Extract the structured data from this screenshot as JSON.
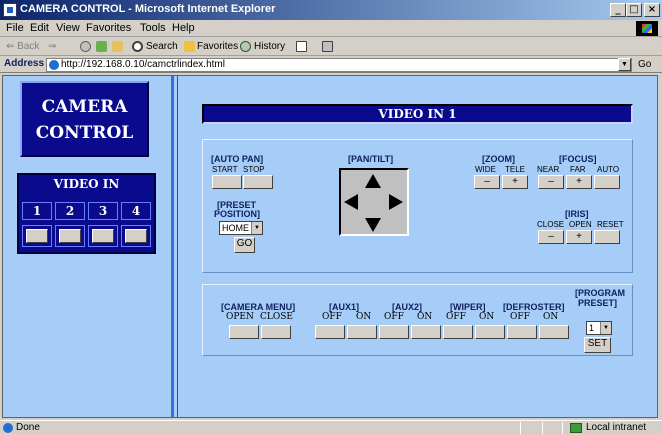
{
  "window": {
    "title": "CAMERA CONTROL - Microsoft Internet Explorer",
    "controls": [
      "_",
      "□",
      "×"
    ]
  },
  "menu": [
    "File",
    "Edit",
    "View",
    "Favorites",
    "Tools",
    "Help"
  ],
  "toolbar": {
    "back": "⇐ Back",
    "forward": "⇒",
    "search": "Search",
    "favorites": "Favorites",
    "history": "History"
  },
  "address": {
    "label": "Address",
    "url": "http://192.168.0.10/camctrlindex.html",
    "go": "Go"
  },
  "left": {
    "logo_line1": "CAMERA",
    "logo_line2": "CONTROL",
    "video_in_title": "VIDEO IN",
    "video_inputs": [
      "1",
      "2",
      "3",
      "4"
    ]
  },
  "main": {
    "title": "VIDEO IN 1",
    "auto_pan": {
      "label": "[AUTO PAN]",
      "start": "START",
      "stop": "STOP"
    },
    "pan_tilt": {
      "label": "[PAN/TILT]"
    },
    "zoom": {
      "label": "[ZOOM]",
      "wide": "WIDE",
      "tele": "TELE",
      "minus": "–",
      "plus": "+"
    },
    "focus": {
      "label": "[FOCUS]",
      "near": "NEAR",
      "far": "FAR",
      "auto": "AUTO",
      "minus": "–",
      "plus": "+"
    },
    "preset": {
      "label_line1": "[PRESET",
      "label_line2": "POSITION]",
      "selected": "HOME",
      "go": "GO"
    },
    "iris": {
      "label": "[IRIS]",
      "close": "CLOSE",
      "open": "OPEN",
      "reset": "RESET",
      "minus": "–",
      "plus": "+"
    },
    "camera_menu": {
      "label": "[CAMERA MENU]",
      "open": "OPEN",
      "close": "CLOSE"
    },
    "aux1": {
      "label": "[AUX1]",
      "off": "OFF",
      "on": "ON"
    },
    "aux2": {
      "label": "[AUX2]",
      "off": "OFF",
      "on": "ON"
    },
    "wiper": {
      "label": "[WIPER]",
      "off": "OFF",
      "on": "ON"
    },
    "defroster": {
      "label": "[DEFROSTER]",
      "off": "OFF",
      "on": "ON"
    },
    "program_preset": {
      "label_line1": "[PROGRAM",
      "label_line2": "PRESET]",
      "selected": "1",
      "set": "SET"
    }
  },
  "status": {
    "text": "Done",
    "zone": "Local intranet"
  },
  "colors": {
    "page_bg": "#a6cdf7",
    "navy": "#0a0a8c",
    "frame_divider": "#3b6fd8"
  }
}
